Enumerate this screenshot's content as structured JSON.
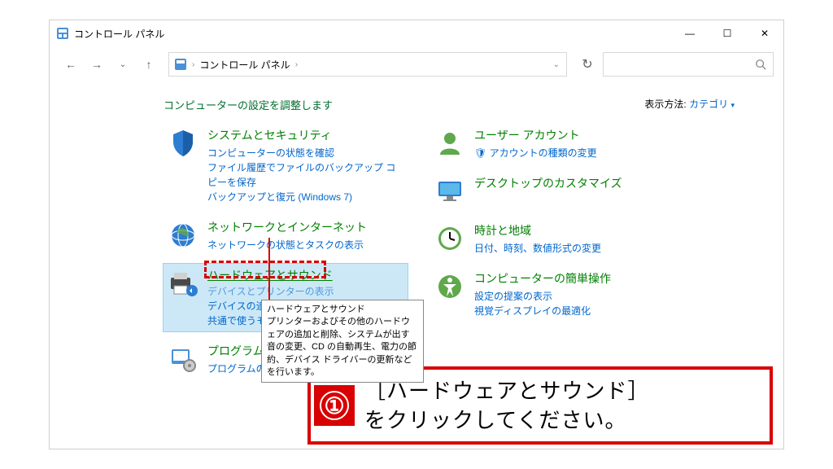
{
  "window": {
    "title": "コントロール パネル",
    "min": "—",
    "max": "☐",
    "close": "✕"
  },
  "nav": {
    "back": "←",
    "fwd": "→",
    "up": "↑",
    "refresh": "↻",
    "search_icon": "🔍"
  },
  "address": {
    "root_sep": "›",
    "root": "コントロール パネル",
    "sep": "›",
    "dropdown": "⌄"
  },
  "content": {
    "heading": "コンピューターの設定を調整します",
    "viewby_label": "表示方法:",
    "viewby_value": "カテゴリ",
    "viewby_tri": "▾"
  },
  "cats": {
    "security": {
      "title": "システムとセキュリティ",
      "l1": "コンピューターの状態を確認",
      "l2": "ファイル履歴でファイルのバックアップ コピーを保存",
      "l3": "バックアップと復元 (Windows 7)"
    },
    "network": {
      "title": "ネットワークとインターネット",
      "l1": "ネットワークの状態とタスクの表示"
    },
    "hardware": {
      "title": "ハードウェアとサウンド",
      "l1": "デバイスとプリンターの表示",
      "l2": "デバイスの追加",
      "l3": "共通で使うモビリティ設定"
    },
    "programs": {
      "title": "プログラム",
      "l1": "プログラムのアンインストール"
    },
    "users": {
      "title": "ユーザー アカウント",
      "l1": "アカウントの種類の変更",
      "shield": "🛡"
    },
    "desktop": {
      "title": "デスクトップのカスタマイズ"
    },
    "clock": {
      "title": "時計と地域",
      "l1": "日付、時刻、数値形式の変更"
    },
    "ease": {
      "title": "コンピューターの簡単操作",
      "l1": "設定の提案の表示",
      "l2": "視覚ディスプレイの最適化"
    }
  },
  "tooltip": {
    "title": "ハードウェアとサウンド",
    "body": "プリンターおよびその他のハードウェアの追加と削除、システムが出す音の変更、CD の自動再生、電力の節約、デバイス ドライバーの更新などを行います。"
  },
  "callout": {
    "num": "①",
    "text_l1": "［ハードウェアとサウンド］",
    "text_l2": "をクリックしてください。"
  }
}
